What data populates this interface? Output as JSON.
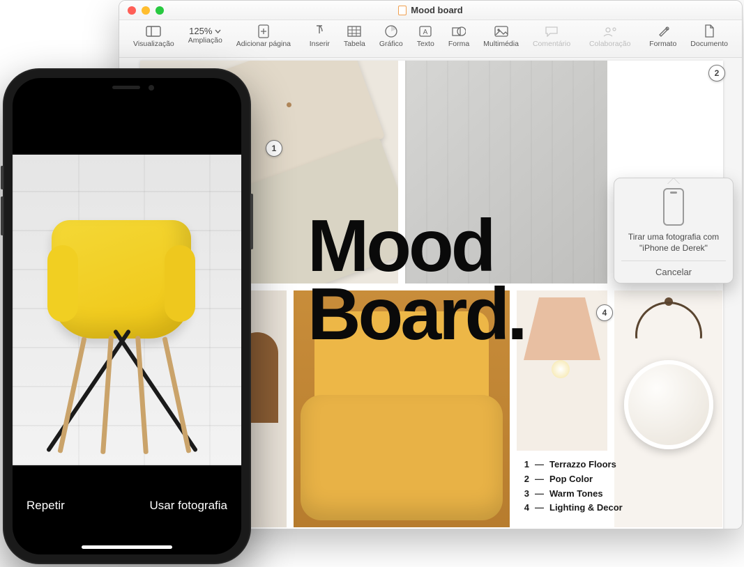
{
  "window": {
    "title": "Mood board"
  },
  "toolbar": {
    "view": "Visualização",
    "zoom_value": "125%",
    "zoom_label": "Ampliação",
    "add_page": "Adicionar página",
    "insert": "Inserir",
    "table": "Tabela",
    "chart": "Gráfico",
    "text": "Texto",
    "shape": "Forma",
    "media": "Multimédia",
    "comment": "Comentário",
    "collab": "Colaboração",
    "format": "Formato",
    "document": "Documento"
  },
  "doc": {
    "headline_line1": "Mood",
    "headline_line2": "Board.",
    "legend": [
      {
        "n": "1",
        "label": "Terrazzo Floors"
      },
      {
        "n": "2",
        "label": "Pop Color"
      },
      {
        "n": "3",
        "label": "Warm Tones"
      },
      {
        "n": "4",
        "label": "Lighting & Decor"
      }
    ],
    "markers": {
      "m1": "1",
      "m2": "2",
      "m4": "4"
    }
  },
  "popover": {
    "line1": "Tirar uma fotografia com",
    "line2": "\"iPhone de Derek\"",
    "cancel": "Cancelar"
  },
  "iphone": {
    "retake": "Repetir",
    "use": "Usar fotografia"
  }
}
